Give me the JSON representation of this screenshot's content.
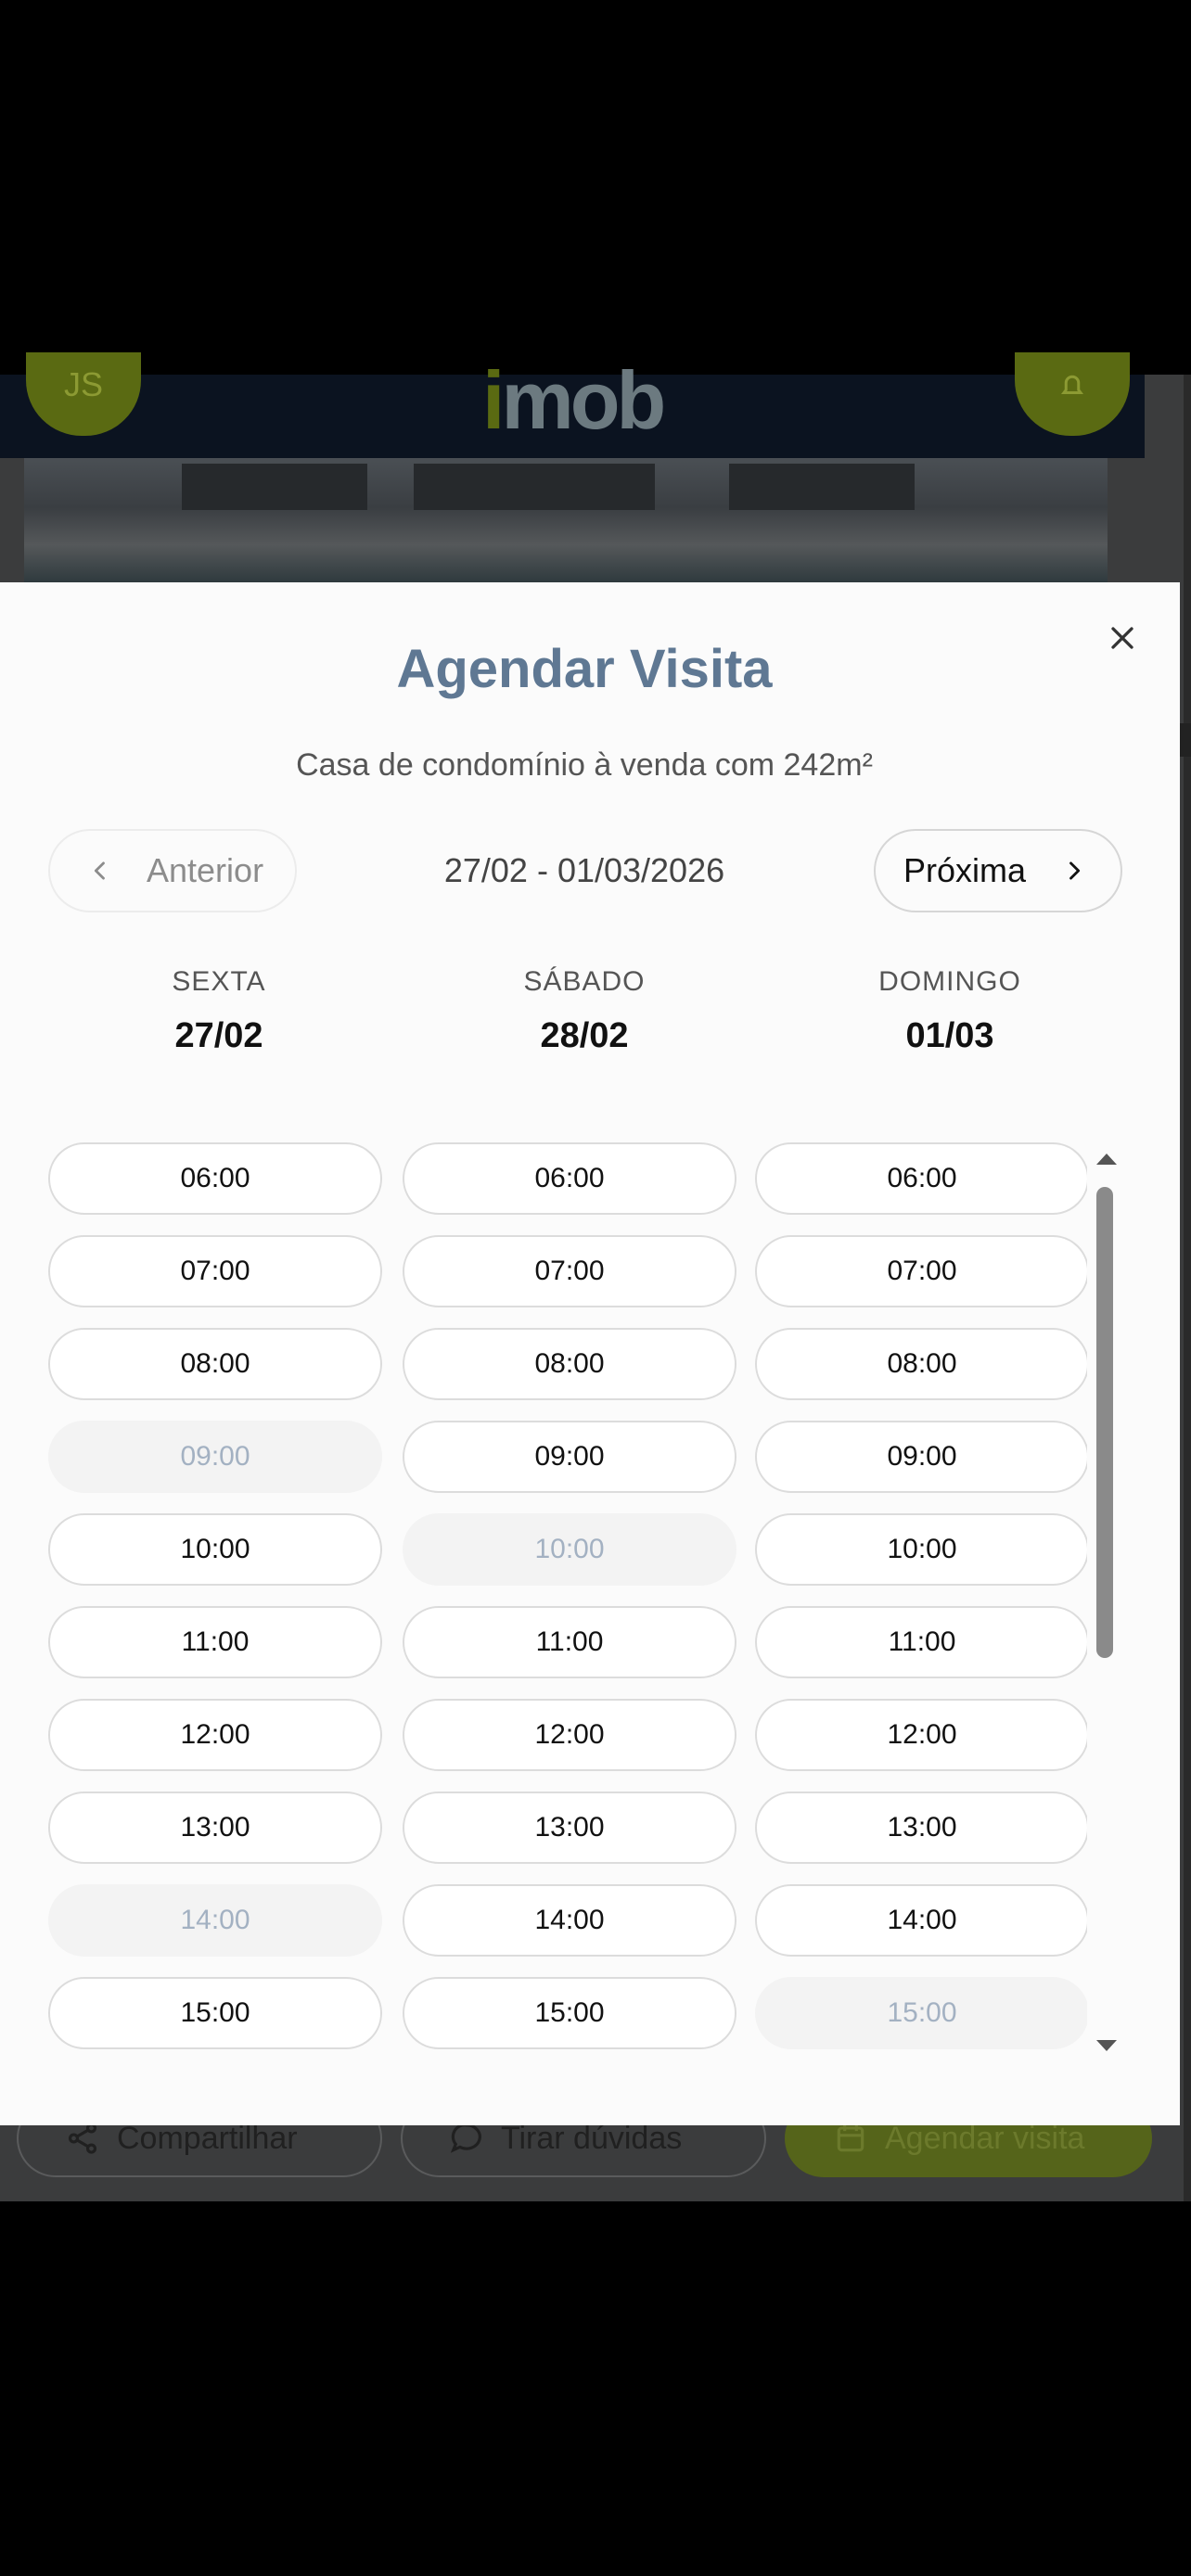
{
  "background": {
    "avatar_initials": "JS",
    "logo_text": {
      "part_i": "i",
      "part_rest": "mob"
    },
    "actions": {
      "share_label": "Compartilhar",
      "doubts_label": "Tirar dúvidas",
      "schedule_label": "Agendar visita"
    }
  },
  "modal": {
    "title": "Agendar Visita",
    "subtitle": "Casa de condomínio à venda com 242m²",
    "nav": {
      "prev_label": "Anterior",
      "next_label": "Próxima",
      "range": "27/02 - 01/03/2026"
    },
    "days": [
      {
        "name": "SEXTA",
        "date": "27/02"
      },
      {
        "name": "SÁBADO",
        "date": "28/02"
      },
      {
        "name": "DOMINGO",
        "date": "01/03"
      }
    ],
    "slots": [
      [
        {
          "time": "06:00",
          "available": true
        },
        {
          "time": "07:00",
          "available": true
        },
        {
          "time": "08:00",
          "available": true
        },
        {
          "time": "09:00",
          "available": false
        },
        {
          "time": "10:00",
          "available": true
        },
        {
          "time": "11:00",
          "available": true
        },
        {
          "time": "12:00",
          "available": true
        },
        {
          "time": "13:00",
          "available": true
        },
        {
          "time": "14:00",
          "available": false
        },
        {
          "time": "15:00",
          "available": true
        }
      ],
      [
        {
          "time": "06:00",
          "available": true
        },
        {
          "time": "07:00",
          "available": true
        },
        {
          "time": "08:00",
          "available": true
        },
        {
          "time": "09:00",
          "available": true
        },
        {
          "time": "10:00",
          "available": false
        },
        {
          "time": "11:00",
          "available": true
        },
        {
          "time": "12:00",
          "available": true
        },
        {
          "time": "13:00",
          "available": true
        },
        {
          "time": "14:00",
          "available": true
        },
        {
          "time": "15:00",
          "available": true
        }
      ],
      [
        {
          "time": "06:00",
          "available": true
        },
        {
          "time": "07:00",
          "available": true
        },
        {
          "time": "08:00",
          "available": true
        },
        {
          "time": "09:00",
          "available": true
        },
        {
          "time": "10:00",
          "available": true
        },
        {
          "time": "11:00",
          "available": true
        },
        {
          "time": "12:00",
          "available": true
        },
        {
          "time": "13:00",
          "available": true
        },
        {
          "time": "14:00",
          "available": true
        },
        {
          "time": "15:00",
          "available": false
        }
      ]
    ]
  },
  "icons": {
    "close": "close-icon",
    "prev": "chevron-left-icon",
    "next": "chevron-right-icon",
    "share": "share-icon",
    "chat": "chat-bubble-icon",
    "calendar": "calendar-icon",
    "bell": "bell-icon"
  },
  "colors": {
    "title": "#5f7893",
    "disabled_text": "#a3b1c2",
    "brand_green": "#55641a",
    "header_dark": "#0b1320"
  }
}
